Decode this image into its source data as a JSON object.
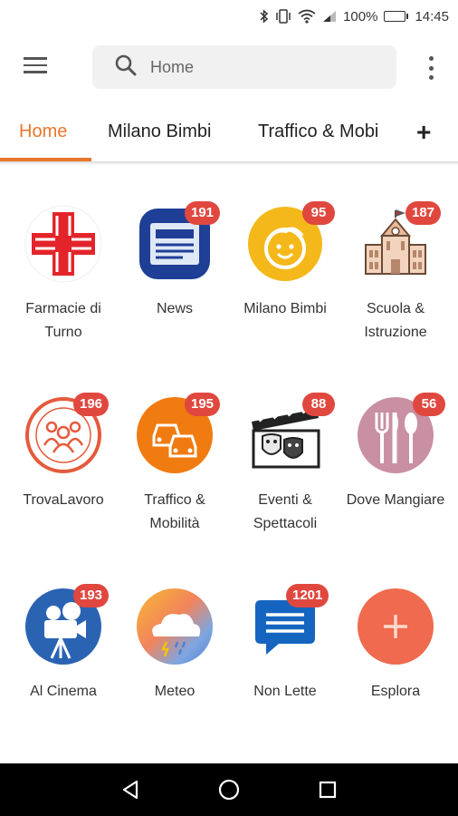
{
  "status_bar": {
    "battery": "100%",
    "time": "14:45"
  },
  "search": {
    "placeholder": "Home"
  },
  "tabs": [
    {
      "label": "Home",
      "active": true
    },
    {
      "label": "Milano Bimbi",
      "active": false
    },
    {
      "label": "Traffico & Mobi",
      "active": false
    }
  ],
  "add_tab_label": "+",
  "tiles": [
    {
      "label": "Farmacie di Turno",
      "badge": "",
      "icon": "pharmacy-cross-icon"
    },
    {
      "label": "News",
      "badge": "191",
      "icon": "newspaper-icon"
    },
    {
      "label": "Milano Bimbi",
      "badge": "95",
      "icon": "child-face-icon"
    },
    {
      "label": "Scuola & Istruzione",
      "badge": "187",
      "icon": "school-building-icon"
    },
    {
      "label": "TrovaLavoro",
      "badge": "196",
      "icon": "people-group-icon"
    },
    {
      "label": "Traffico & Mobilità",
      "badge": "195",
      "icon": "traffic-cars-icon"
    },
    {
      "label": "Eventi & Spettacoli",
      "badge": "88",
      "icon": "theater-clapper-icon"
    },
    {
      "label": "Dove Mangiare",
      "badge": "56",
      "icon": "cutlery-icon"
    },
    {
      "label": "Al Cinema",
      "badge": "193",
      "icon": "movie-camera-icon"
    },
    {
      "label": "Meteo",
      "badge": "",
      "icon": "weather-icon"
    },
    {
      "label": "Non Lette",
      "badge": "1201",
      "icon": "chat-bubble-icon"
    },
    {
      "label": "Esplora",
      "badge": "",
      "icon": "add-circle-icon"
    }
  ],
  "colors": {
    "accent": "#e8772e",
    "badge": "#e0483f"
  }
}
